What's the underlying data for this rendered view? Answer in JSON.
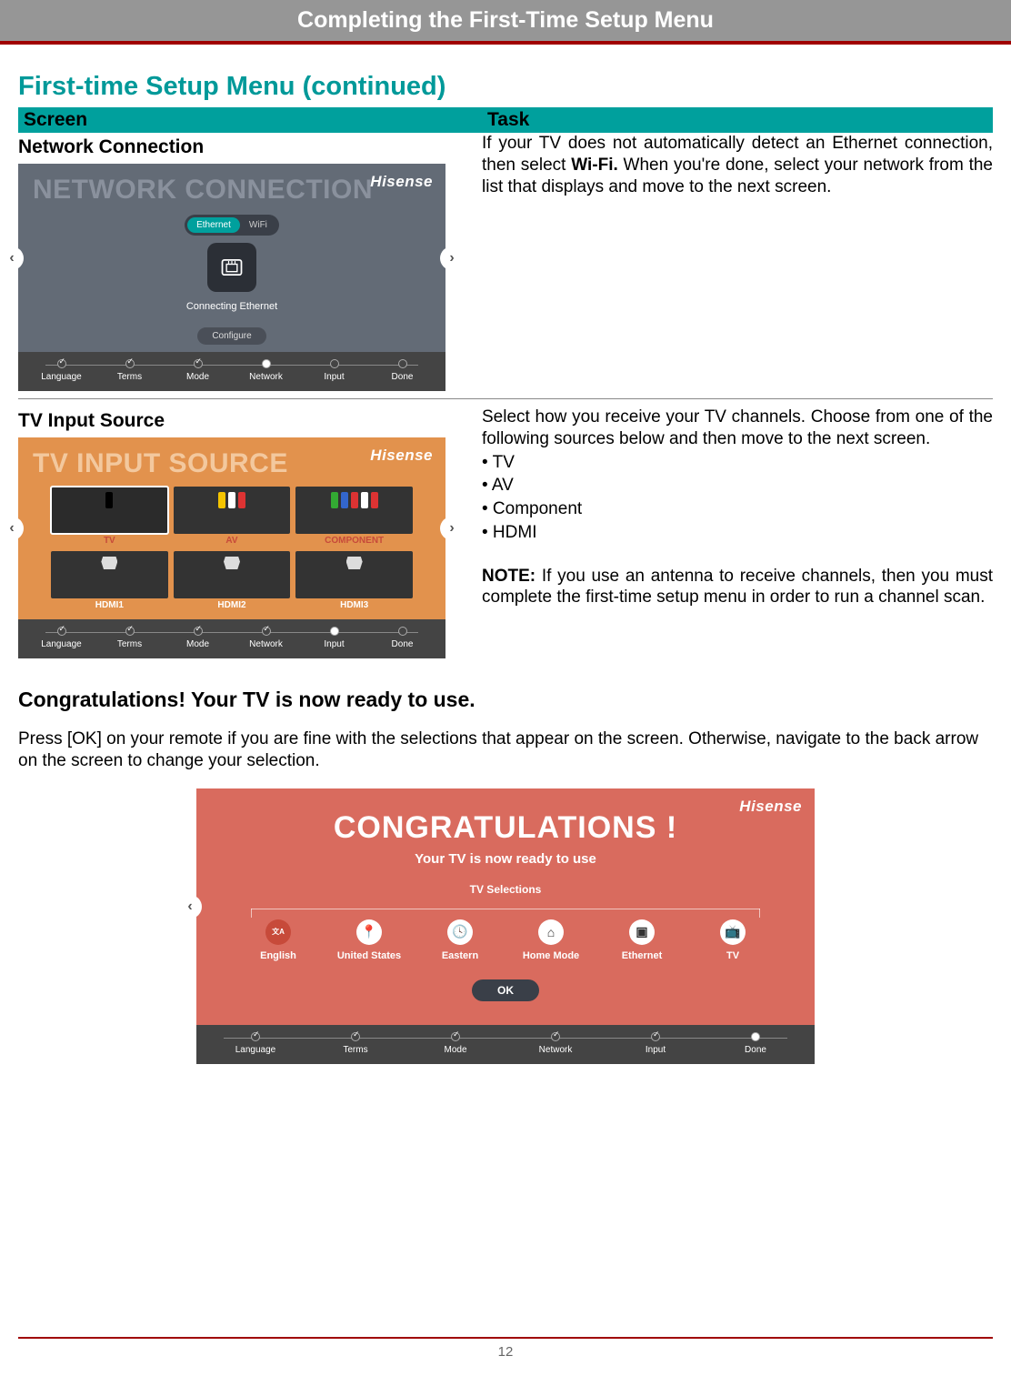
{
  "header": {
    "title": "Completing the First-Time Setup Menu"
  },
  "section_title": "First-time Setup Menu (continued)",
  "table": {
    "col1": "Screen",
    "col2": "Task"
  },
  "brand": "Hisense",
  "nav": {
    "left": "‹",
    "right": "›"
  },
  "steps": {
    "s0": "Language",
    "s1": "Terms",
    "s2": "Mode",
    "s3": "Network",
    "s4": "Input",
    "s5": "Done"
  },
  "row1": {
    "title": "Network Connection",
    "screen_title": "NETWORK CONNECTION",
    "toggle_on": "Ethernet",
    "toggle_off": "WiFi",
    "status": "Connecting Ethernet",
    "button": "Configure",
    "task_a": "If your TV does not automatically detect an Ethernet con­nection, then select ",
    "task_bold": "Wi-Fi.",
    "task_b": " When you're done, select your network from the list that displays and move to the next screen."
  },
  "row2": {
    "title": "TV Input Source",
    "screen_title": "TV INPUT SOURCE",
    "src": {
      "tv": "TV",
      "av": "AV",
      "comp": "COMPONENT",
      "h1": "HDMI1",
      "h2": "HDMI2",
      "h3": "HDMI3"
    },
    "task_intro": "Select how you receive your TV channels. Choose from one of the following sources below and then move to the next screen.",
    "b1": "• TV",
    "b2": "• AV",
    "b3": "• Component",
    "b4": "• HDMI",
    "note_label": "NOTE:",
    "note_text": " If you use an antenna to receive channels, then you must complete the first-time setup menu in order to run a channel scan."
  },
  "congrats": {
    "heading": "Congratulations! Your TV is now ready to use.",
    "para": "Press [OK] on your remote if you are fine with the selections that appear on the screen. Otherwise, navigate to the back arrow on the screen to change your selection.",
    "screen_title": "CONGRATULATIONS !",
    "subtitle": "Your TV is now ready to use",
    "selections_label": "TV Selections",
    "items": {
      "i0": "English",
      "i1": "United States",
      "i2": "Eastern",
      "i3": "Home Mode",
      "i4": "Ethernet",
      "i5": "TV"
    },
    "icons": {
      "i0": "文A",
      "i1": "📍",
      "i2": "🕓",
      "i3": "⌂",
      "i4": "▣",
      "i5": "📺"
    },
    "ok": "OK"
  },
  "page_number": "12"
}
